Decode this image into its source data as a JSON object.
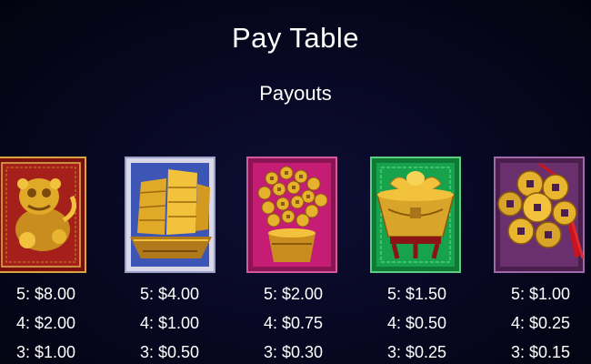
{
  "header": {
    "title": "Pay Table",
    "subtitle": "Payouts"
  },
  "symbols": [
    {
      "icon": "foo-dog-icon",
      "frame_color": "#9a1a16",
      "payouts": [
        "5: $8.00",
        "4: $2.00",
        "3: $1.00"
      ]
    },
    {
      "icon": "junk-ship-icon",
      "frame_color": "#3f58b8",
      "payouts": [
        "5: $4.00",
        "4: $1.00",
        "3: $0.50"
      ]
    },
    {
      "icon": "money-tree-icon",
      "frame_color": "#c01a72",
      "payouts": [
        "5: $2.00",
        "4: $0.75",
        "3: $0.30"
      ]
    },
    {
      "icon": "gold-ingot-bowl-icon",
      "frame_color": "#16a04a",
      "payouts": [
        "5: $1.50",
        "4: $0.50",
        "3: $0.25"
      ]
    },
    {
      "icon": "lucky-coins-icon",
      "frame_color": "#6a2f6d",
      "payouts": [
        "5: $1.00",
        "4: $0.25",
        "3: $0.15"
      ]
    }
  ]
}
